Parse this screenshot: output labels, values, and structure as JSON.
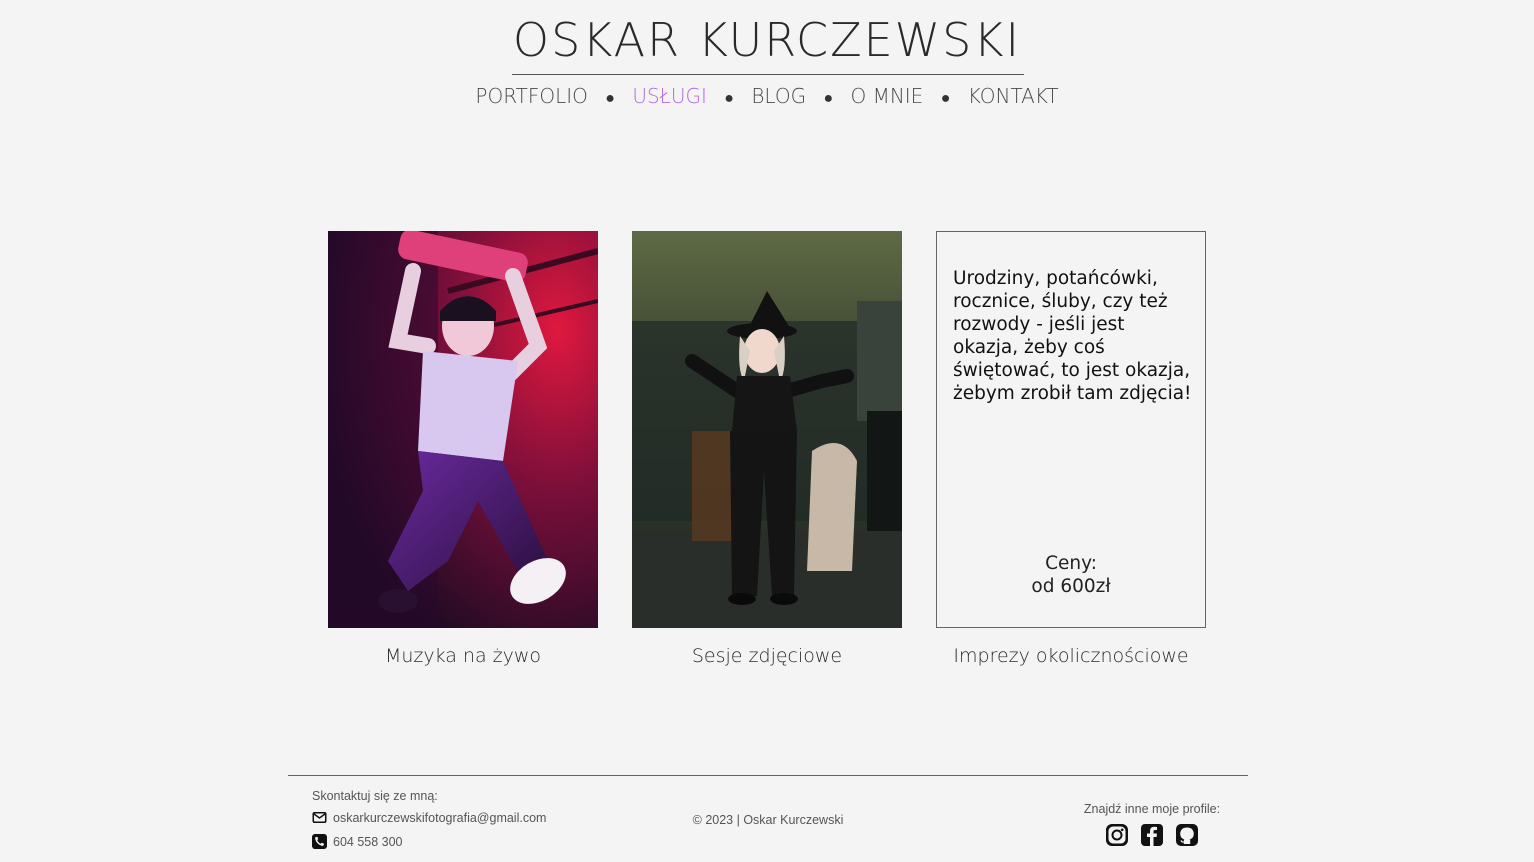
{
  "header": {
    "title": "OSKAR KURCZEWSKI",
    "nav": [
      {
        "label": "PORTFOLIO",
        "active": false
      },
      {
        "label": "USŁUGI",
        "active": true
      },
      {
        "label": "BLOG",
        "active": false
      },
      {
        "label": "O MNIE",
        "active": false
      },
      {
        "label": "KONTAKT",
        "active": false
      }
    ],
    "accent_color": "#b36ae0"
  },
  "services": [
    {
      "caption": "Muzyka na żywo",
      "kind": "photo",
      "image": "concert-performer-photo"
    },
    {
      "caption": "Sesje zdjęciowe",
      "kind": "photo",
      "image": "witch-costume-portrait-photo"
    },
    {
      "caption": "Imprezy okolicznościowe",
      "kind": "text",
      "description": "Urodziny, potańcówki, rocznice, śluby, czy też rozwody - jeśli jest okazja, żeby coś świętować, to jest okazja, żebym zrobił tam zdjęcia!",
      "price_label": "Ceny:",
      "price_value": "od 600zł"
    }
  ],
  "footer": {
    "contact_heading": "Skontaktuj się ze mną:",
    "email": "oskarkurczewskifotografia@gmail.com",
    "phone": "604 558 300",
    "copyright": "© 2023 | Oskar Kurczewski",
    "profiles_heading": "Znajdź inne moje profile:",
    "social_icons": [
      "instagram-icon",
      "facebook-icon",
      "github-icon"
    ]
  }
}
